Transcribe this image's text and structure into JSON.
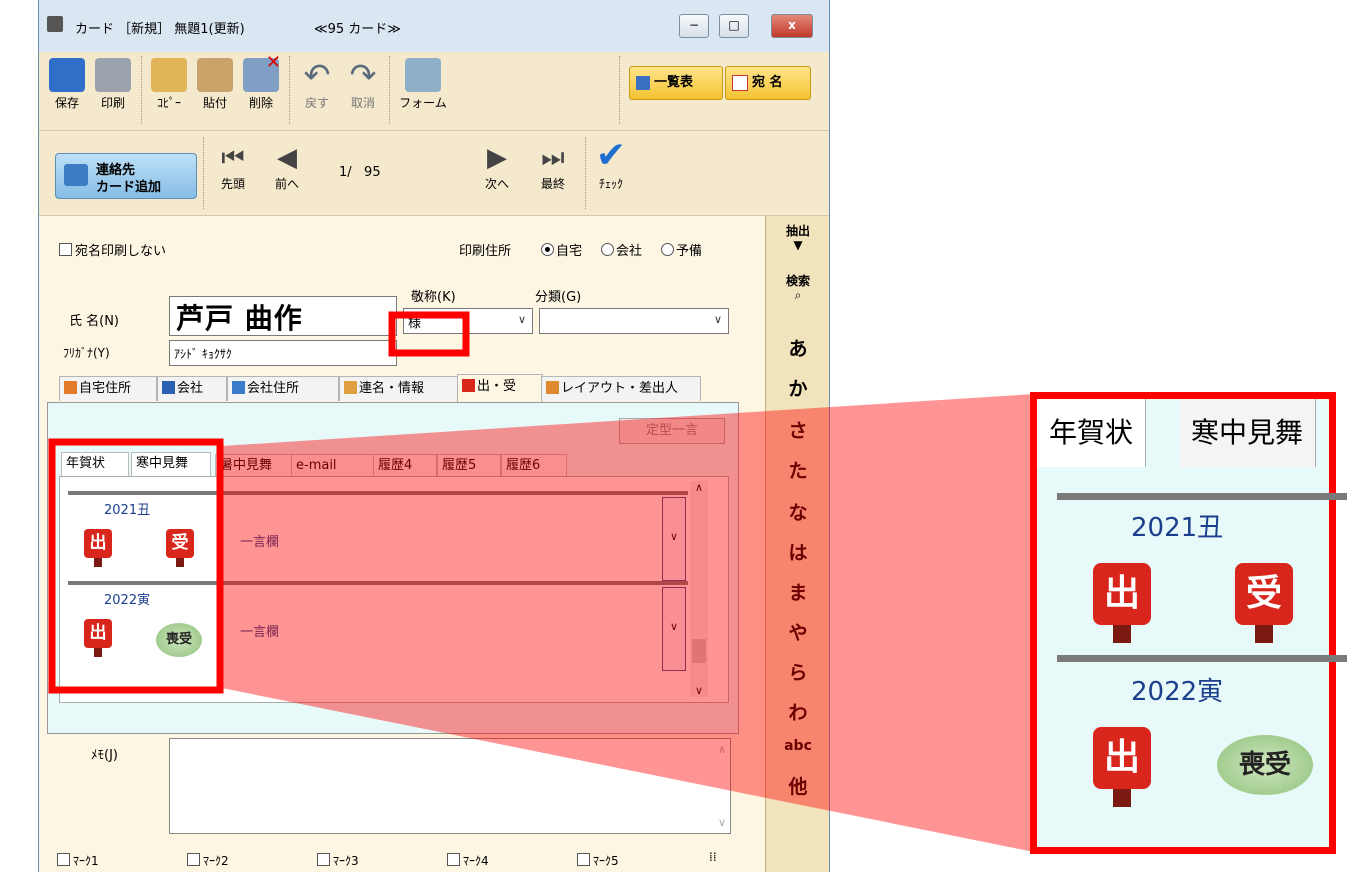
{
  "window": {
    "title": "カード ［新規］ 無題1(更新)",
    "subtitle": "≪95 カード≫",
    "min_glyph": "−",
    "max_glyph": "□",
    "close_glyph": "x"
  },
  "toolbar": {
    "save": "保存",
    "print": "印刷",
    "copy": "ｺﾋﾟｰ",
    "paste": "貼付",
    "delete": "削除",
    "undo": "戻す",
    "cancel": "取消",
    "form": "フォーム",
    "list": "一覧表",
    "address": "宛 名"
  },
  "nav": {
    "add_contact_l1": "連絡先",
    "add_contact_l2": "カード追加",
    "first": "先頭",
    "prev": "前へ",
    "position": "1/   95",
    "next": "次へ",
    "last": "最終",
    "check": "ﾁｪｯｸ"
  },
  "form": {
    "no_print_label": "宛名印刷しない",
    "print_address_label": "印刷住所",
    "radio_home": "自宅",
    "radio_company": "会社",
    "radio_spare": "予備",
    "name_label": "氏 名(N)",
    "name_value": "芦戸 曲作",
    "furigana_label": "ﾌﾘｶﾞﾅ(Y)",
    "furigana_value": "ｱｼﾄﾞ ｷｮｸｻｸ",
    "honorific_label": "敬称(K)",
    "honorific_value": "様",
    "category_label": "分類(G)",
    "category_value": ""
  },
  "tabs": [
    "自宅住所",
    "会社",
    "会社住所",
    "連名・情報",
    "出・受",
    "レイアウト・差出人"
  ],
  "history": {
    "teikei_button": "定型一言",
    "subtabs": [
      "年賀状",
      "寒中見舞",
      "暑中見舞",
      "e-mail",
      "履歴4",
      "履歴5",
      "履歴6"
    ],
    "rows": [
      {
        "year": "2021丑",
        "sent": "出",
        "received": "受",
        "note": "一言欄"
      },
      {
        "year": "2022寅",
        "sent": "出",
        "received": "喪受",
        "note": "一言欄"
      }
    ]
  },
  "memo": {
    "label": "ﾒﾓ(J)",
    "value": ""
  },
  "marks": [
    "ﾏｰｸ1",
    "ﾏｰｸ2",
    "ﾏｰｸ3",
    "ﾏｰｸ4",
    "ﾏｰｸ5"
  ],
  "kana_index": {
    "filter": "抽出",
    "search": "検索",
    "letters": [
      "あ",
      "か",
      "さ",
      "た",
      "な",
      "は",
      "ま",
      "や",
      "ら",
      "わ"
    ],
    "abc": "abc",
    "other": "他"
  },
  "zoom": {
    "tabs": [
      "年賀状",
      "寒中見舞"
    ],
    "rows": [
      {
        "year": "2021丑",
        "sent": "出",
        "received": "受"
      },
      {
        "year": "2022寅",
        "sent": "出",
        "received": "喪受"
      }
    ]
  },
  "colors": {
    "highlight": "#ff0000",
    "panel": "#e7f9f9",
    "toolbar": "#f4e9cd",
    "post": "#d9261c"
  }
}
